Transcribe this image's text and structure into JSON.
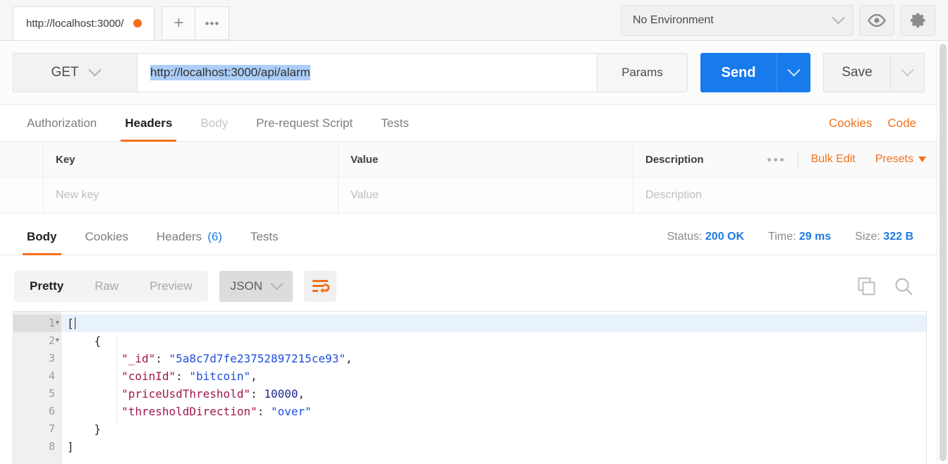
{
  "tabstrip": {
    "request_tab_label": "http://localhost:3000/",
    "unsaved_dot": "unsaved-indicator",
    "new_tab_icon": "+",
    "more_tabs_icon": "•••"
  },
  "environment": {
    "selected": "No Environment",
    "eye_icon": "eye-icon",
    "gear_icon": "gear-icon"
  },
  "request": {
    "method": "GET",
    "url": "http://localhost:3000/api/alarm",
    "url_selected": true,
    "params_label": "Params",
    "send_label": "Send",
    "save_label": "Save"
  },
  "request_tabs": [
    {
      "label": "Authorization",
      "state": "normal"
    },
    {
      "label": "Headers",
      "state": "active"
    },
    {
      "label": "Body",
      "state": "disabled"
    },
    {
      "label": "Pre-request Script",
      "state": "normal"
    },
    {
      "label": "Tests",
      "state": "normal"
    }
  ],
  "request_tab_links": {
    "cookies": "Cookies",
    "code": "Code"
  },
  "headers_table": {
    "columns": [
      "Key",
      "Value",
      "Description"
    ],
    "actions": {
      "more_icon": "•••",
      "bulk_edit": "Bulk Edit",
      "presets": "Presets"
    },
    "new_row": {
      "key_placeholder": "New key",
      "value_placeholder": "Value",
      "description_placeholder": "Description"
    }
  },
  "response_tabs": [
    {
      "label": "Body",
      "state": "active",
      "count": ""
    },
    {
      "label": "Cookies",
      "state": "normal",
      "count": ""
    },
    {
      "label": "Headers",
      "state": "normal",
      "count": "(6)"
    },
    {
      "label": "Tests",
      "state": "normal",
      "count": ""
    }
  ],
  "response_meta": {
    "status_label": "Status:",
    "status_value": "200 OK",
    "time_label": "Time:",
    "time_value": "29 ms",
    "size_label": "Size:",
    "size_value": "322 B"
  },
  "response_toolbar": {
    "view_modes": [
      {
        "label": "Pretty",
        "state": "active"
      },
      {
        "label": "Raw",
        "state": "normal"
      },
      {
        "label": "Preview",
        "state": "normal"
      }
    ],
    "format": "JSON",
    "wrap_icon": "word-wrap-icon",
    "copy_icon": "copy-icon",
    "search_icon": "search-icon"
  },
  "response_body": {
    "language": "json",
    "active_line": 1,
    "line_numbers": [
      "1",
      "2",
      "3",
      "4",
      "5",
      "6",
      "7",
      "8"
    ],
    "foldable_lines": [
      "1",
      "2"
    ],
    "lines": [
      {
        "n": "1",
        "indent": 0,
        "tokens": [
          {
            "t": "[",
            "c": "p"
          }
        ]
      },
      {
        "n": "2",
        "indent": 1,
        "tokens": [
          {
            "t": "{",
            "c": "p"
          }
        ]
      },
      {
        "n": "3",
        "indent": 2,
        "tokens": [
          {
            "t": "\"_id\"",
            "c": "k"
          },
          {
            "t": ": ",
            "c": "p"
          },
          {
            "t": "\"5a8c7d7fe23752897215ce93\"",
            "c": "s"
          },
          {
            "t": ",",
            "c": "p"
          }
        ]
      },
      {
        "n": "4",
        "indent": 2,
        "tokens": [
          {
            "t": "\"coinId\"",
            "c": "k"
          },
          {
            "t": ": ",
            "c": "p"
          },
          {
            "t": "\"bitcoin\"",
            "c": "s"
          },
          {
            "t": ",",
            "c": "p"
          }
        ]
      },
      {
        "n": "5",
        "indent": 2,
        "tokens": [
          {
            "t": "\"priceUsdThreshold\"",
            "c": "k"
          },
          {
            "t": ": ",
            "c": "p"
          },
          {
            "t": "10000",
            "c": "n"
          },
          {
            "t": ",",
            "c": "p"
          }
        ]
      },
      {
        "n": "6",
        "indent": 2,
        "tokens": [
          {
            "t": "\"thresholdDirection\"",
            "c": "k"
          },
          {
            "t": ": ",
            "c": "p"
          },
          {
            "t": "\"over\"",
            "c": "s"
          }
        ]
      },
      {
        "n": "7",
        "indent": 1,
        "tokens": [
          {
            "t": "}",
            "c": "p"
          }
        ]
      },
      {
        "n": "8",
        "indent": 0,
        "tokens": [
          {
            "t": "]",
            "c": "p"
          }
        ]
      }
    ],
    "raw_text": "[\n    {\n        \"_id\": \"5a8c7d7fe23752897215ce93\",\n        \"coinId\": \"bitcoin\",\n        \"priceUsdThreshold\": 10000,\n        \"thresholdDirection\": \"over\"\n    }\n]"
  },
  "colors": {
    "accent_orange": "#f2711c",
    "send_blue": "#177bec",
    "status_blue": "#1f7ae0",
    "selection_blue": "#accef7",
    "json_key": "#a1174f",
    "json_string": "#1d4fe0",
    "json_number": "#1f2a8a"
  }
}
